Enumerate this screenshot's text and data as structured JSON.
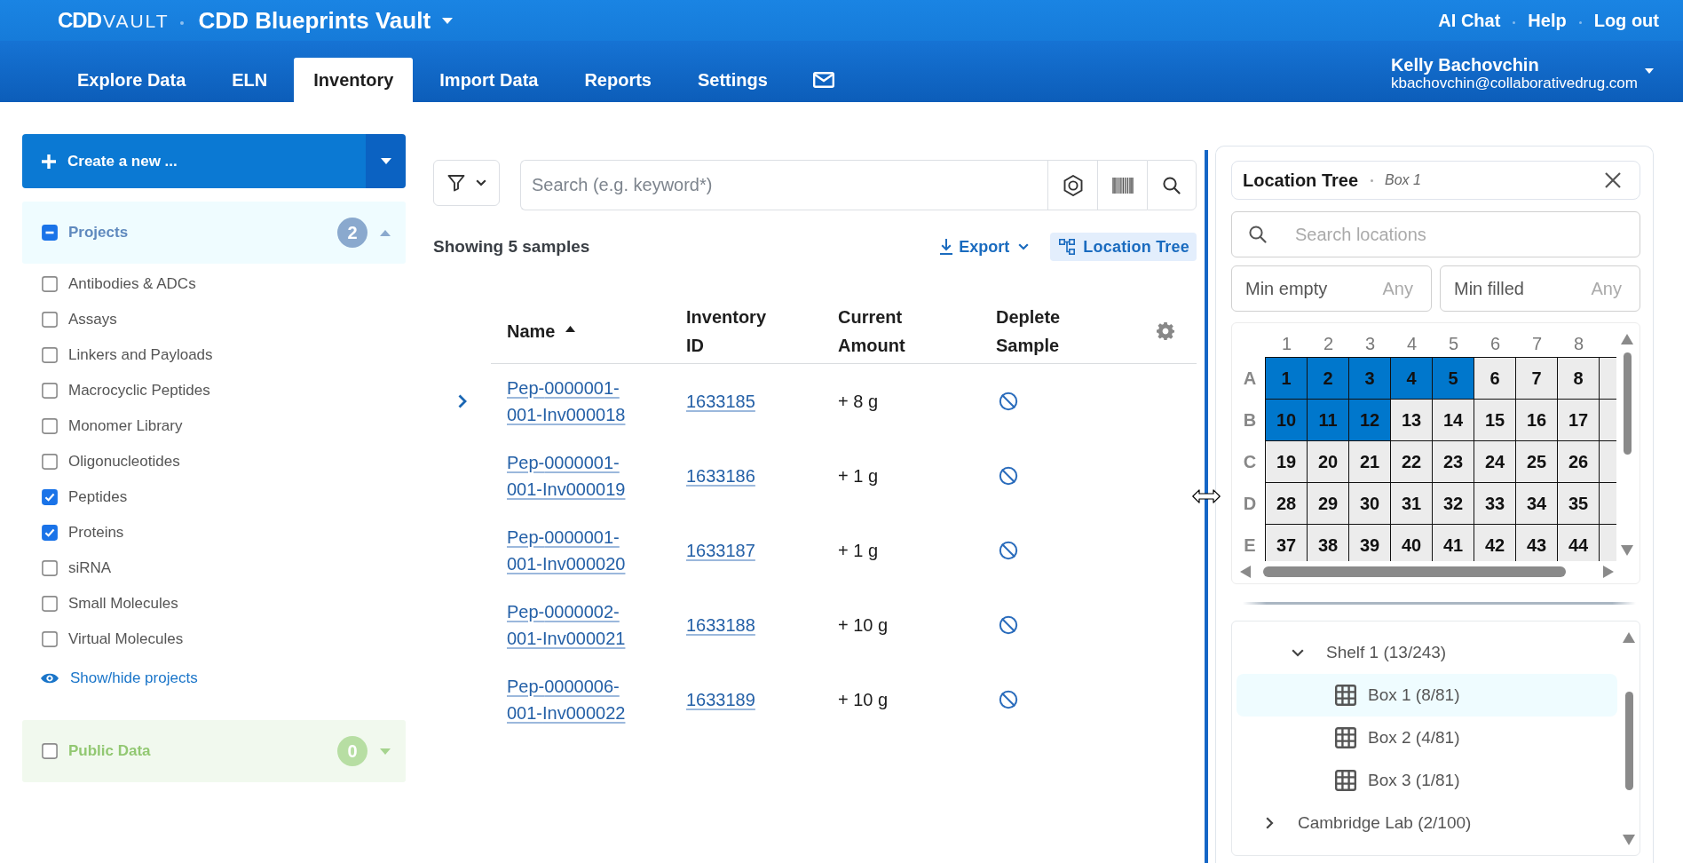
{
  "top_bar": {
    "logo": {
      "brand": "CDD",
      "product": "VAULT"
    },
    "vault_name": "CDD Blueprints Vault",
    "links": [
      "AI Chat",
      "Help",
      "Log out"
    ]
  },
  "nav": {
    "tabs": [
      {
        "label": "Explore Data",
        "selected": false
      },
      {
        "label": "ELN",
        "selected": false
      },
      {
        "label": "Inventory",
        "selected": true
      },
      {
        "label": "Import Data",
        "selected": false
      },
      {
        "label": "Reports",
        "selected": false
      },
      {
        "label": "Settings",
        "selected": false
      }
    ],
    "user": {
      "name": "Kelly Bachovchin",
      "email": "kbachovchin@collaborativedrug.com"
    }
  },
  "sidebar": {
    "create_button": "Create a new ...",
    "projects": {
      "title": "Projects",
      "count": "2",
      "indeterminate": true,
      "expanded": true,
      "items": [
        {
          "label": "Antibodies & ADCs",
          "checked": false
        },
        {
          "label": "Assays",
          "checked": false
        },
        {
          "label": "Linkers and Payloads",
          "checked": false
        },
        {
          "label": "Macrocyclic Peptides",
          "checked": false
        },
        {
          "label": "Monomer Library",
          "checked": false
        },
        {
          "label": "Oligonucleotides",
          "checked": false
        },
        {
          "label": "Peptides",
          "checked": true
        },
        {
          "label": "Proteins",
          "checked": true
        },
        {
          "label": "siRNA",
          "checked": false
        },
        {
          "label": "Small Molecules",
          "checked": false
        },
        {
          "label": "Virtual Molecules",
          "checked": false
        }
      ],
      "show_hide": "Show/hide projects"
    },
    "public_data": {
      "title": "Public Data",
      "count": "0",
      "checked": false,
      "expanded": false
    }
  },
  "search": {
    "placeholder": "Search (e.g. keyword*)"
  },
  "results": {
    "summary": "Showing 5 samples",
    "export": "Export",
    "location_tree": {
      "label": "Location Tree",
      "active": true
    }
  },
  "table": {
    "columns": [
      {
        "label": "Name",
        "sorted": true
      },
      {
        "label": "Inventory ID",
        "sorted": false
      },
      {
        "label": "Current Amount",
        "sorted": false
      },
      {
        "label": "Deplete Sample",
        "sorted": false
      }
    ],
    "rows": [
      {
        "name": "Pep-0000001-001-Inv000018",
        "inventory_id": "1633185",
        "amount": "+ 8 g",
        "hovered": true
      },
      {
        "name": "Pep-0000001-001-Inv000019",
        "inventory_id": "1633186",
        "amount": "+ 1 g",
        "hovered": false
      },
      {
        "name": "Pep-0000001-001-Inv000020",
        "inventory_id": "1633187",
        "amount": "+ 1 g",
        "hovered": false
      },
      {
        "name": "Pep-0000002-001-Inv000021",
        "inventory_id": "1633188",
        "amount": "+ 10 g",
        "hovered": false
      },
      {
        "name": "Pep-0000006-001-Inv000022",
        "inventory_id": "1633189",
        "amount": "+ 10 g",
        "hovered": false
      }
    ]
  },
  "location_panel": {
    "title": "Location Tree",
    "subtitle": "Box 1",
    "search": {
      "placeholder": "Search locations"
    },
    "filters": [
      {
        "label": "Min empty",
        "placeholder": "Any"
      },
      {
        "label": "Min filled",
        "placeholder": "Any"
      }
    ],
    "grid": {
      "columns": [
        "1",
        "2",
        "3",
        "4",
        "5",
        "6",
        "7",
        "8"
      ],
      "rows": [
        {
          "label": "A",
          "cells": [
            {
              "label": "1",
              "filled": true
            },
            {
              "label": "2",
              "filled": true
            },
            {
              "label": "3",
              "filled": true
            },
            {
              "label": "4",
              "filled": true
            },
            {
              "label": "5",
              "filled": true
            },
            {
              "label": "6",
              "filled": false
            },
            {
              "label": "7",
              "filled": false
            },
            {
              "label": "8",
              "filled": false
            },
            {
              "filled": false
            }
          ]
        },
        {
          "label": "B",
          "cells": [
            {
              "label": "10",
              "filled": true
            },
            {
              "label": "11",
              "filled": true
            },
            {
              "label": "12",
              "filled": true
            },
            {
              "label": "13",
              "filled": false
            },
            {
              "label": "14",
              "filled": false
            },
            {
              "label": "15",
              "filled": false
            },
            {
              "label": "16",
              "filled": false
            },
            {
              "label": "17",
              "filled": false
            },
            {
              "filled": false
            }
          ]
        },
        {
          "label": "C",
          "cells": [
            {
              "label": "19",
              "filled": false
            },
            {
              "label": "20",
              "filled": false
            },
            {
              "label": "21",
              "filled": false
            },
            {
              "label": "22",
              "filled": false
            },
            {
              "label": "23",
              "filled": false
            },
            {
              "label": "24",
              "filled": false
            },
            {
              "label": "25",
              "filled": false
            },
            {
              "label": "26",
              "filled": false
            },
            {
              "filled": false
            }
          ]
        },
        {
          "label": "D",
          "cells": [
            {
              "label": "28",
              "filled": false
            },
            {
              "label": "29",
              "filled": false
            },
            {
              "label": "30",
              "filled": false
            },
            {
              "label": "31",
              "filled": false
            },
            {
              "label": "32",
              "filled": false
            },
            {
              "label": "33",
              "filled": false
            },
            {
              "label": "34",
              "filled": false
            },
            {
              "label": "35",
              "filled": false
            },
            {
              "filled": false
            }
          ]
        },
        {
          "label": "E",
          "cells": [
            {
              "label": "37",
              "filled": false
            },
            {
              "label": "38",
              "filled": false
            },
            {
              "label": "39",
              "filled": false
            },
            {
              "label": "40",
              "filled": false
            },
            {
              "label": "41",
              "filled": false
            },
            {
              "label": "42",
              "filled": false
            },
            {
              "label": "43",
              "filled": false
            },
            {
              "label": "44",
              "filled": false
            },
            {
              "filled": false
            }
          ]
        }
      ]
    },
    "tree": [
      {
        "children": [
          {
            "kind": "container",
            "label": "Shelf 1 (13/243)",
            "expanded": true,
            "selected": false,
            "children": [
              {
                "kind": "box",
                "label": "Box 1 (8/81)",
                "selected": true
              },
              {
                "kind": "box",
                "label": "Box 2 (4/81)",
                "selected": false
              },
              {
                "kind": "box",
                "label": "Box 3 (1/81)",
                "selected": false
              }
            ]
          }
        ]
      },
      {
        "kind": "container",
        "label": "Cambridge Lab (2/100)",
        "expanded": false,
        "selected": false
      }
    ]
  }
}
